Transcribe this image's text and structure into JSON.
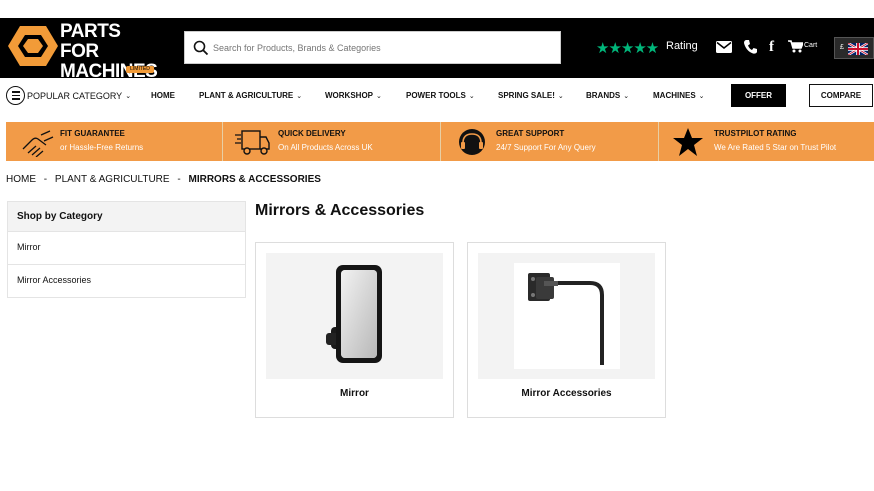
{
  "header": {
    "logo_line1": "PARTS FOR",
    "logo_line2": "MACHINES",
    "logo_badge": "LIMITED",
    "search_placeholder": "Search for Products, Brands & Categories",
    "rating_stars": "★★★★★",
    "rating_label": "Rating",
    "cart_label": "Cart",
    "currency": "£",
    "accent_color": "#f29b48"
  },
  "nav": {
    "popular": "POPULAR CATEGORY",
    "items": [
      {
        "label": "HOME",
        "dropdown": false
      },
      {
        "label": "PLANT & AGRICULTURE",
        "dropdown": true
      },
      {
        "label": "WORKSHOP",
        "dropdown": true
      },
      {
        "label": "POWER TOOLS",
        "dropdown": true
      },
      {
        "label": "SPRING SALE!",
        "dropdown": true
      },
      {
        "label": "BRANDS",
        "dropdown": true
      },
      {
        "label": "MACHINES",
        "dropdown": true
      }
    ],
    "offer": "OFFER",
    "compare": "COMPARE"
  },
  "usps": [
    {
      "title": "FIT GUARANTEE",
      "subtitle": "or Hassle-Free Returns",
      "icon": "handshake-icon"
    },
    {
      "title": "QUICK DELIVERY",
      "subtitle": "On All Products Across UK",
      "icon": "delivery-truck-icon"
    },
    {
      "title": "GREAT SUPPORT",
      "subtitle": "24/7 Support For Any Query",
      "icon": "headset-icon"
    },
    {
      "title": "TRUSTPILOT RATING",
      "subtitle": "We Are Rated 5 Star on Trust Pilot",
      "icon": "star-icon"
    }
  ],
  "breadcrumb": {
    "home": "HOME",
    "sep": "-",
    "parent": "PLANT & AGRICULTURE",
    "current": "MIRRORS & ACCESSORIES"
  },
  "sidebar": {
    "heading": "Shop by Category",
    "items": [
      "Mirror",
      "Mirror Accessories"
    ]
  },
  "main": {
    "title": "Mirrors & Accessories",
    "products": [
      {
        "label": "Mirror",
        "image": "mirror-image"
      },
      {
        "label": "Mirror Accessories",
        "image": "mirror-bracket-image"
      }
    ]
  }
}
